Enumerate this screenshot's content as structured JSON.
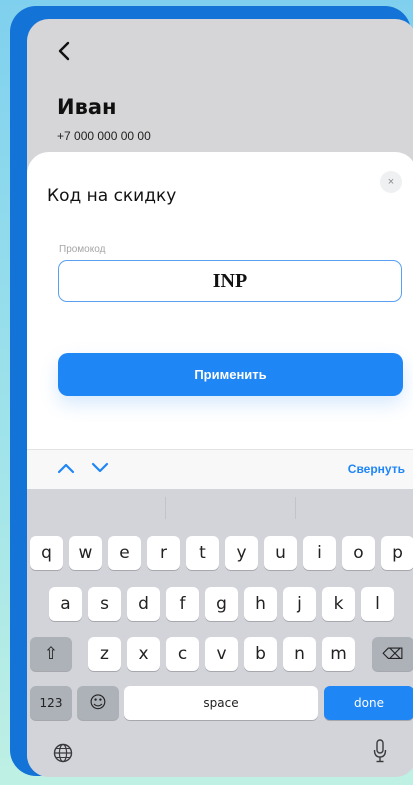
{
  "profile": {
    "name": "Иван",
    "phone": "+7 000 000 00 00"
  },
  "sheet": {
    "title": "Код на скидку",
    "close_glyph": "×",
    "field_label": "Промокод",
    "input_value": "INP",
    "apply_label": "Применить"
  },
  "toolbar": {
    "collapse_label": "Свернуть"
  },
  "keyboard": {
    "row1": [
      "q",
      "w",
      "e",
      "r",
      "t",
      "y",
      "u",
      "i",
      "o",
      "p"
    ],
    "row2": [
      "a",
      "s",
      "d",
      "f",
      "g",
      "h",
      "j",
      "k",
      "l"
    ],
    "row3": [
      "z",
      "x",
      "c",
      "v",
      "b",
      "n",
      "m"
    ],
    "numbers_label": "123",
    "emoji_glyph": "☺",
    "space_label": "space",
    "done_label": "done",
    "shift_glyph": "⇧",
    "backspace_glyph": "⌫"
  },
  "colors": {
    "accent": "#1f86f6",
    "frame": "#1473d6"
  },
  "icons": [
    "back-chevron-icon",
    "close-icon",
    "chevron-up-icon",
    "chevron-down-icon",
    "globe-icon",
    "microphone-icon",
    "shift-icon",
    "backspace-icon",
    "emoji-icon"
  ]
}
